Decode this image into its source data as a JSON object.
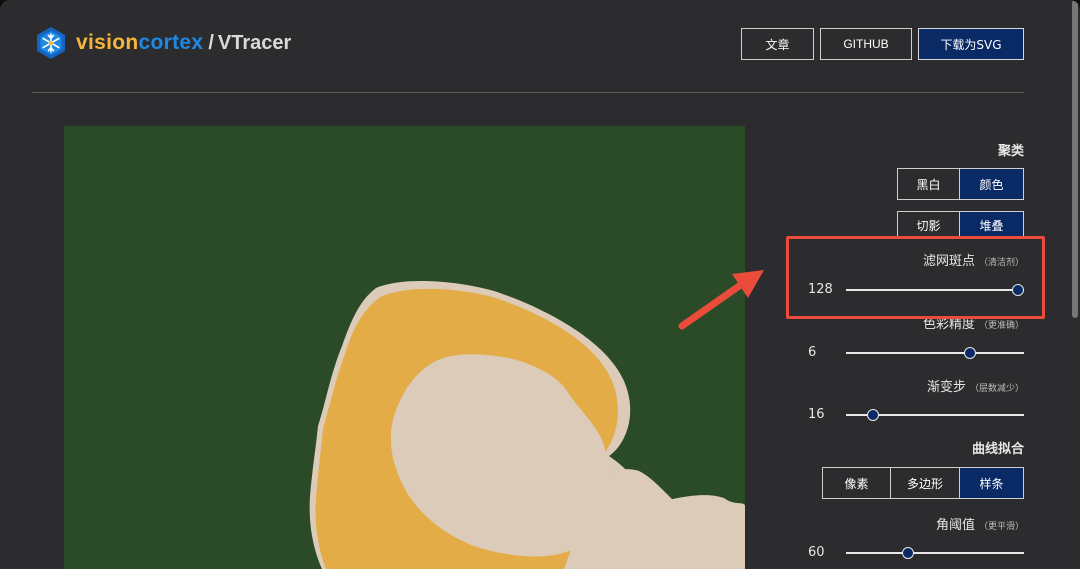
{
  "header": {
    "brand_part1": "vision",
    "brand_part2": "cortex",
    "brand_sep": "/",
    "product_name": "VTracer",
    "buttons": {
      "article": "文章",
      "github": "GITHUB",
      "download": "下载为SVG"
    },
    "logo_icon": "snowflake-hex-logo"
  },
  "panel": {
    "clustering": {
      "title": "聚类",
      "color_mode": {
        "options": [
          "黑白",
          "颜色"
        ],
        "selected": "颜色"
      },
      "hierarchy": {
        "options": [
          "切影",
          "堆叠"
        ],
        "selected": "堆叠"
      }
    },
    "filter_speckle": {
      "label": "滤网斑点",
      "hint": "（清洁剂）",
      "value": "128",
      "level": 1.0
    },
    "color_precision": {
      "label": "色彩精度",
      "hint": "（更准确）",
      "value": "6",
      "level": 0.7
    },
    "gradient_step": {
      "label": "渐变步",
      "hint": "（层数减少）",
      "value": "16",
      "level": 0.15
    },
    "curve_fitting": {
      "title": "曲线拟合",
      "options": [
        "像素",
        "多边形",
        "样条"
      ],
      "selected": "样条"
    },
    "corner_threshold": {
      "label": "角阈值",
      "hint": "（更平滑）",
      "value": "60",
      "level": 0.35
    }
  },
  "colors": {
    "accent": "#0a2a66",
    "canvas_bg": "#2a4a28",
    "ring": "#e3ac47",
    "shape": "#dccbb9",
    "highlight": "#ea4b3b"
  }
}
